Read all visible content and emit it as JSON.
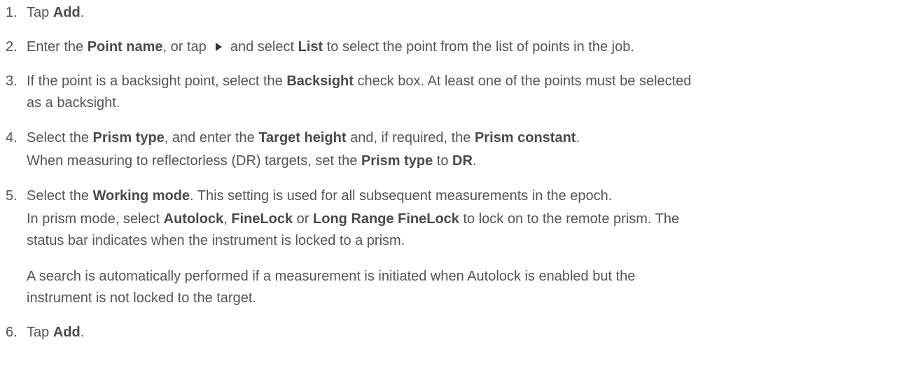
{
  "steps": [
    {
      "num": "1.",
      "lines": [
        [
          {
            "t": "Tap "
          },
          {
            "b": "Add"
          },
          {
            "t": "."
          }
        ]
      ]
    },
    {
      "num": "2.",
      "lines": [
        [
          {
            "t": "Enter the "
          },
          {
            "b": "Point name"
          },
          {
            "t": ", or tap "
          },
          {
            "icon": "play-arrow-icon"
          },
          {
            "t": " and select "
          },
          {
            "b": "List"
          },
          {
            "t": " to select the point from the list of points in the job."
          }
        ]
      ]
    },
    {
      "num": "3.",
      "lines": [
        [
          {
            "t": "If the point is a backsight point, select the "
          },
          {
            "b": "Backsight"
          },
          {
            "t": " check box. At least one of the points must be selected"
          }
        ],
        [
          {
            "t": "as a backsight."
          }
        ]
      ]
    },
    {
      "num": "4.",
      "lines": [
        [
          {
            "t": "Select the "
          },
          {
            "b": "Prism type"
          },
          {
            "t": ", and enter the "
          },
          {
            "b": "Target height"
          },
          {
            "t": " and, if required, the "
          },
          {
            "b": "Prism constant"
          },
          {
            "t": "."
          }
        ],
        [
          {
            "t": "When measuring to reflectorless (DR) targets, set the "
          },
          {
            "b": "Prism type"
          },
          {
            "t": " to "
          },
          {
            "b": "DR"
          },
          {
            "t": "."
          }
        ]
      ]
    },
    {
      "num": "5.",
      "lines": [
        [
          {
            "t": "Select the "
          },
          {
            "b": "Working mode"
          },
          {
            "t": ". This setting is used for all subsequent measurements in the epoch."
          }
        ],
        [
          {
            "t": "In prism mode, select "
          },
          {
            "b": "Autolock"
          },
          {
            "t": ", "
          },
          {
            "b": "FineLock"
          },
          {
            "t": " or "
          },
          {
            "b": "Long Range FineLock"
          },
          {
            "t": " to lock on to the remote prism. The"
          }
        ],
        [
          {
            "t": "status bar indicates when the instrument is locked to a prism."
          }
        ],
        [
          {
            "t": "A search is automatically performed if a measurement is initiated when Autolock is enabled but the"
          }
        ],
        [
          {
            "t": "instrument is not locked to the target."
          }
        ]
      ]
    },
    {
      "num": "6.",
      "lines": [
        [
          {
            "t": "Tap "
          },
          {
            "b": "Add"
          },
          {
            "t": "."
          }
        ]
      ]
    }
  ]
}
